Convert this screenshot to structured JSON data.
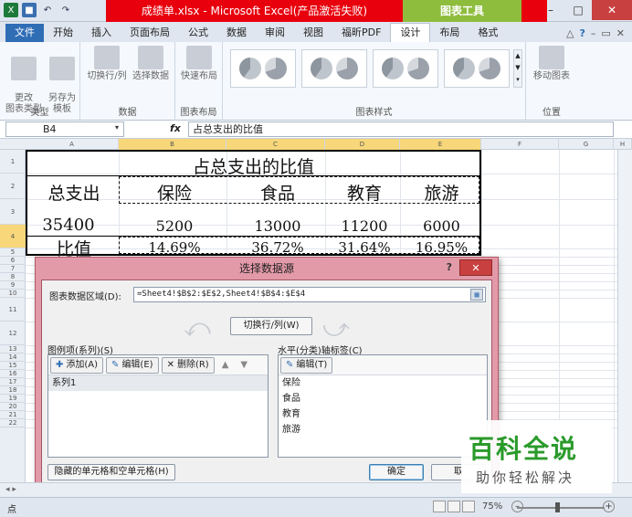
{
  "titlebar": {
    "title": "成绩单.xlsx - Microsoft Excel(产品激活失败)",
    "tools_tab": "图表工具"
  },
  "tabs": [
    "文件",
    "开始",
    "插入",
    "页面布局",
    "公式",
    "数据",
    "审阅",
    "视图",
    "福昕PDF",
    "设计",
    "布局",
    "格式"
  ],
  "ribbon": {
    "type_group": {
      "change_type": "更改\n图表类型",
      "save_template": "另存为\n模板",
      "label": "类型"
    },
    "data_group": {
      "switch": "切换行/列",
      "select": "选择数据",
      "label": "数据"
    },
    "layout_group": {
      "quick_layout": "快速布局",
      "label": "图表布局"
    },
    "styles_group": {
      "label": "图表样式"
    },
    "location_group": {
      "move_chart": "移动图表",
      "label": "位置"
    }
  },
  "formula_bar": {
    "name_box": "B4",
    "fx": "fx",
    "content": "占总支出的比值"
  },
  "columns": [
    "A",
    "B",
    "C",
    "D",
    "E",
    "F",
    "G",
    "H"
  ],
  "rows": [
    "1",
    "2",
    "3",
    "4",
    "5",
    "6",
    "7",
    "8",
    "9",
    "10",
    "11",
    "12",
    "13",
    "14",
    "15",
    "16",
    "17",
    "18",
    "19",
    "20",
    "21",
    "22"
  ],
  "table": {
    "title": "占总支出的比值",
    "header": [
      "总支出",
      "保险",
      "食品",
      "教育",
      "旅游"
    ],
    "values": [
      "35400",
      "5200",
      "13000",
      "11200",
      "6000"
    ],
    "ratio_label": "比值",
    "ratios": [
      "14.69%",
      "36.72%",
      "31.64%",
      "16.95%"
    ]
  },
  "dialog": {
    "title": "选择数据源",
    "help": "?",
    "close": "✕",
    "range_label": "图表数据区域(D):",
    "range_value": "=Sheet4!$B$2:$E$2,Sheet4!$B$4:$E$4",
    "switch_button": "切换行/列(W)",
    "legend_label": "图例项(系列)(S)",
    "add": "添加(A)",
    "edit": "编辑(E)",
    "remove": "删除(R)",
    "series": [
      "系列1"
    ],
    "axis_label": "水平(分类)轴标签(C)",
    "axis_edit": "编辑(T)",
    "categories": [
      "保险",
      "食品",
      "教育",
      "旅游"
    ],
    "hidden_cells": "隐藏的单元格和空单元格(H)",
    "ok": "确定",
    "cancel": "取"
  },
  "status": {
    "ready": "点",
    "zoom": "75%"
  },
  "watermark": {
    "main": "百科全说",
    "sub": "助你轻松解决"
  },
  "colors": {
    "title_red": "#e8000d",
    "tools_green": "#8ebd3e",
    "dialog_pink": "#e39aa8",
    "selected_header": "#f7d77a"
  }
}
